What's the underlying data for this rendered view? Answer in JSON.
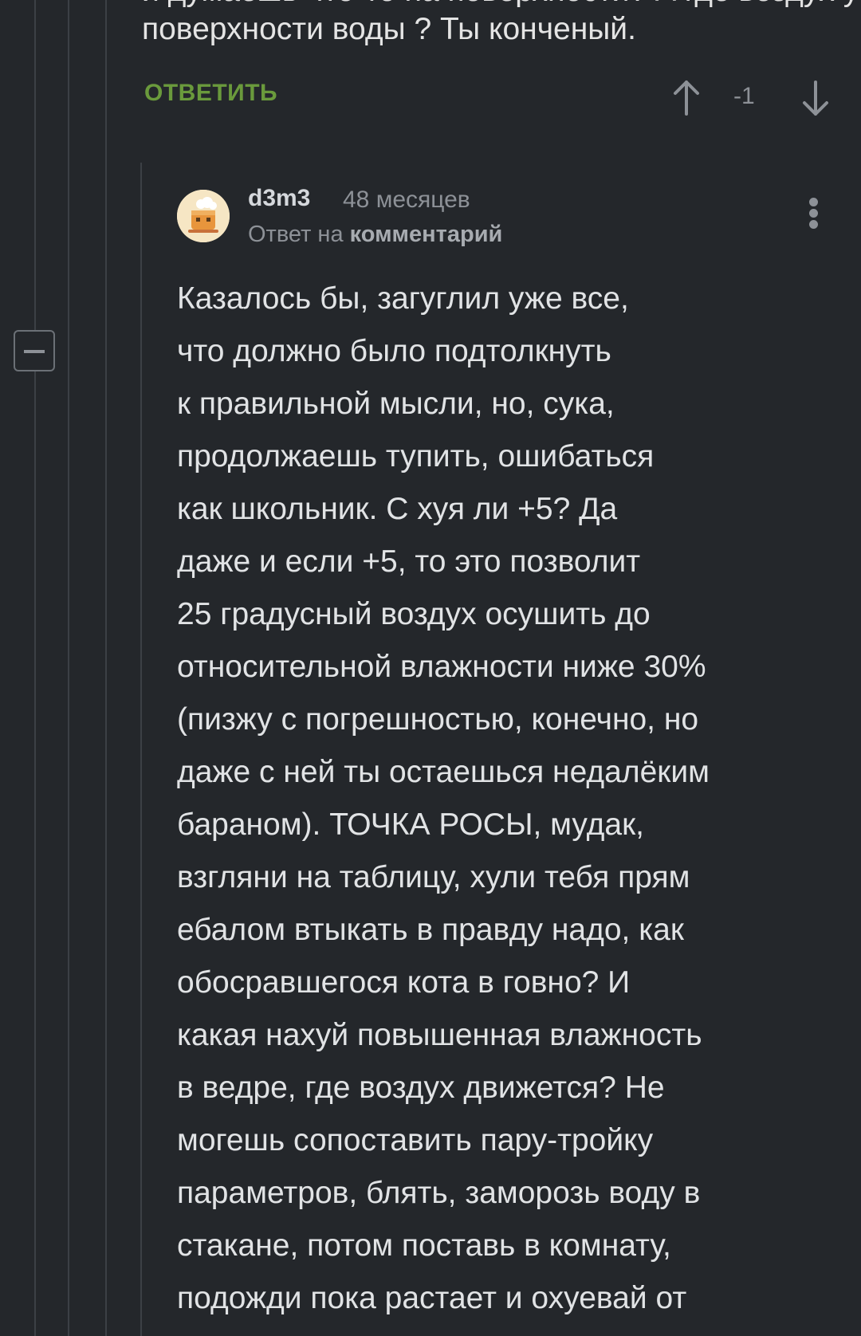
{
  "previous_comment": {
    "clipped_line": "и думаешь что-то на поверхности? А где воздух у",
    "last_line": "поверхности воды ? Ты конченый.",
    "reply_label": "ОТВЕТИТЬ",
    "score": "-1"
  },
  "comment": {
    "author": "d3m3",
    "time": "48 месяцев",
    "reply_to_prefix": "Ответ на",
    "reply_to_target": "комментарий",
    "lines": [
      "Казалось бы, загуглил уже все,",
      "что должно было подтолкнуть",
      "к правильной мысли, но, сука,",
      "продолжаешь тупить, ошибаться",
      "как школьник. С хуя ли +5? Да",
      "даже и если +5, то это позволит",
      "25 градусный воздух осушить до",
      "относительной влажности ниже 30%",
      "(пизжу с погрешностью, конечно, но",
      "даже с ней ты остаешься недалёким",
      "бараном). ТОЧКА РОСЫ, мудак,",
      "взгляни на таблицу, хули тебя прям",
      "ебалом втыкать в правду надо, как",
      "обосравшегося кота в говно? И",
      "какая нахуй повышенная влажность",
      "в ведре, где воздух движется? Не",
      "могешь сопоставить пару-тройку",
      "параметров, блять, заморозь воду в",
      "стакане, потом поставь в комнату,",
      "подожди пока растает и охуевай от"
    ]
  },
  "icons": {
    "vote_up": "arrow-up-icon",
    "vote_down": "arrow-down-icon",
    "more": "more-vertical-icon",
    "collapse": "minus-icon",
    "avatar": "avatar-image"
  },
  "colors": {
    "background": "#24272b",
    "text": "#e1e3e5",
    "muted": "#8d9197",
    "reply_accent": "#6a9a3c",
    "thread_line": "#3c4045"
  }
}
